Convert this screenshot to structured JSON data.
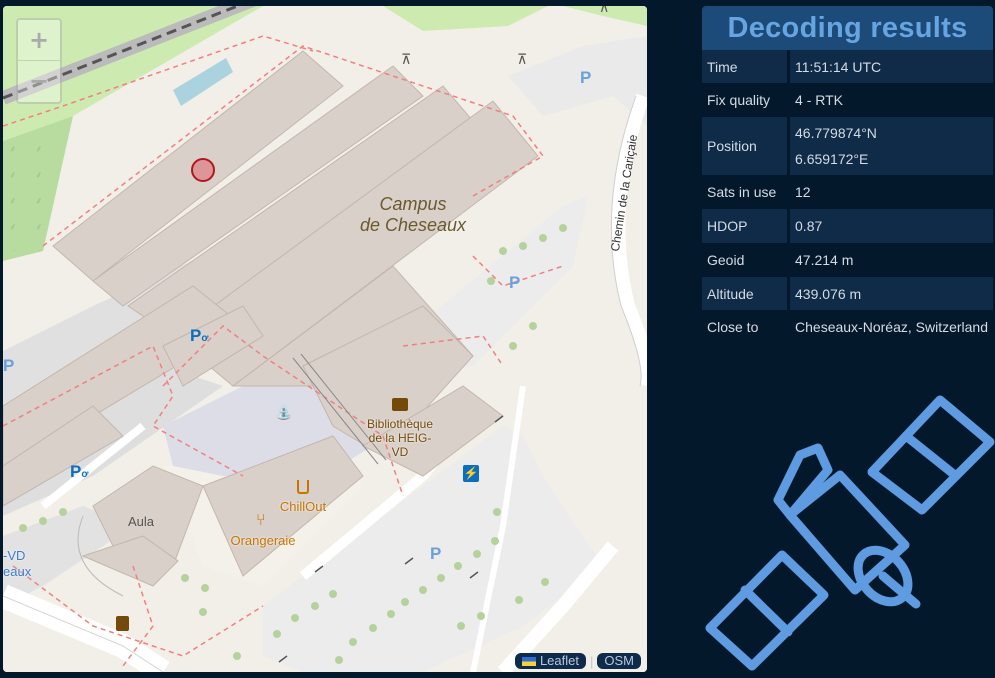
{
  "map": {
    "zoom_in_label": "+",
    "zoom_out_label": "−",
    "labels": {
      "campus_line1": "Campus",
      "campus_line2": "de Cheseaux",
      "road": "Chemin de la Cariçaie",
      "library_line1": "Bibliothèque",
      "library_line2": "de la HEIG-",
      "library_line3": "VD",
      "chillout": "ChillOut",
      "orangeraie": "Orangeraie",
      "aula": "Aula",
      "cut_label1": "-VD",
      "cut_label2": "eaux",
      "parking": "P"
    },
    "attribution": {
      "leaflet": "Leaflet",
      "separator": "|",
      "osm": "OSM"
    },
    "colors": {
      "background": "#f2efe9",
      "building": "#d9d0c9",
      "building_outline": "#c4b6ab",
      "grass": "#cdebb0",
      "parking_area": "#eeeeee",
      "boundary": "#f08080",
      "marker": "#b01820"
    }
  },
  "panel": {
    "title": "Decoding results",
    "rows": [
      {
        "key": "Time",
        "value": "11:51:14 UTC"
      },
      {
        "key": "Fix quality",
        "value": "4 - RTK"
      },
      {
        "key": "Position",
        "value": "46.779874°N",
        "value2": "6.659172°E"
      },
      {
        "key": "Sats in use",
        "value": "12"
      },
      {
        "key": "HDOP",
        "value": "0.87"
      },
      {
        "key": "Geoid",
        "value": "47.214 m"
      },
      {
        "key": "Altitude",
        "value": "439.076 m"
      },
      {
        "key": "Close to",
        "value": "Cheseaux-Noréaz, Switzerland"
      }
    ],
    "colors": {
      "title_bg": "#1c4a79",
      "title_text": "#67a5e0",
      "row_alt": "#0f2b47",
      "background": "#04182c"
    }
  },
  "icons": {
    "satellite": "satellite-icon",
    "picnic": "picnic-table-icon",
    "bicycle_parking": "bicycle-parking-icon",
    "fountain": "fountain-icon",
    "library": "library-icon",
    "cafe": "cafe-icon",
    "restaurant": "restaurant-icon",
    "ev_charging": "charging-station-icon",
    "marker": "position-marker"
  }
}
